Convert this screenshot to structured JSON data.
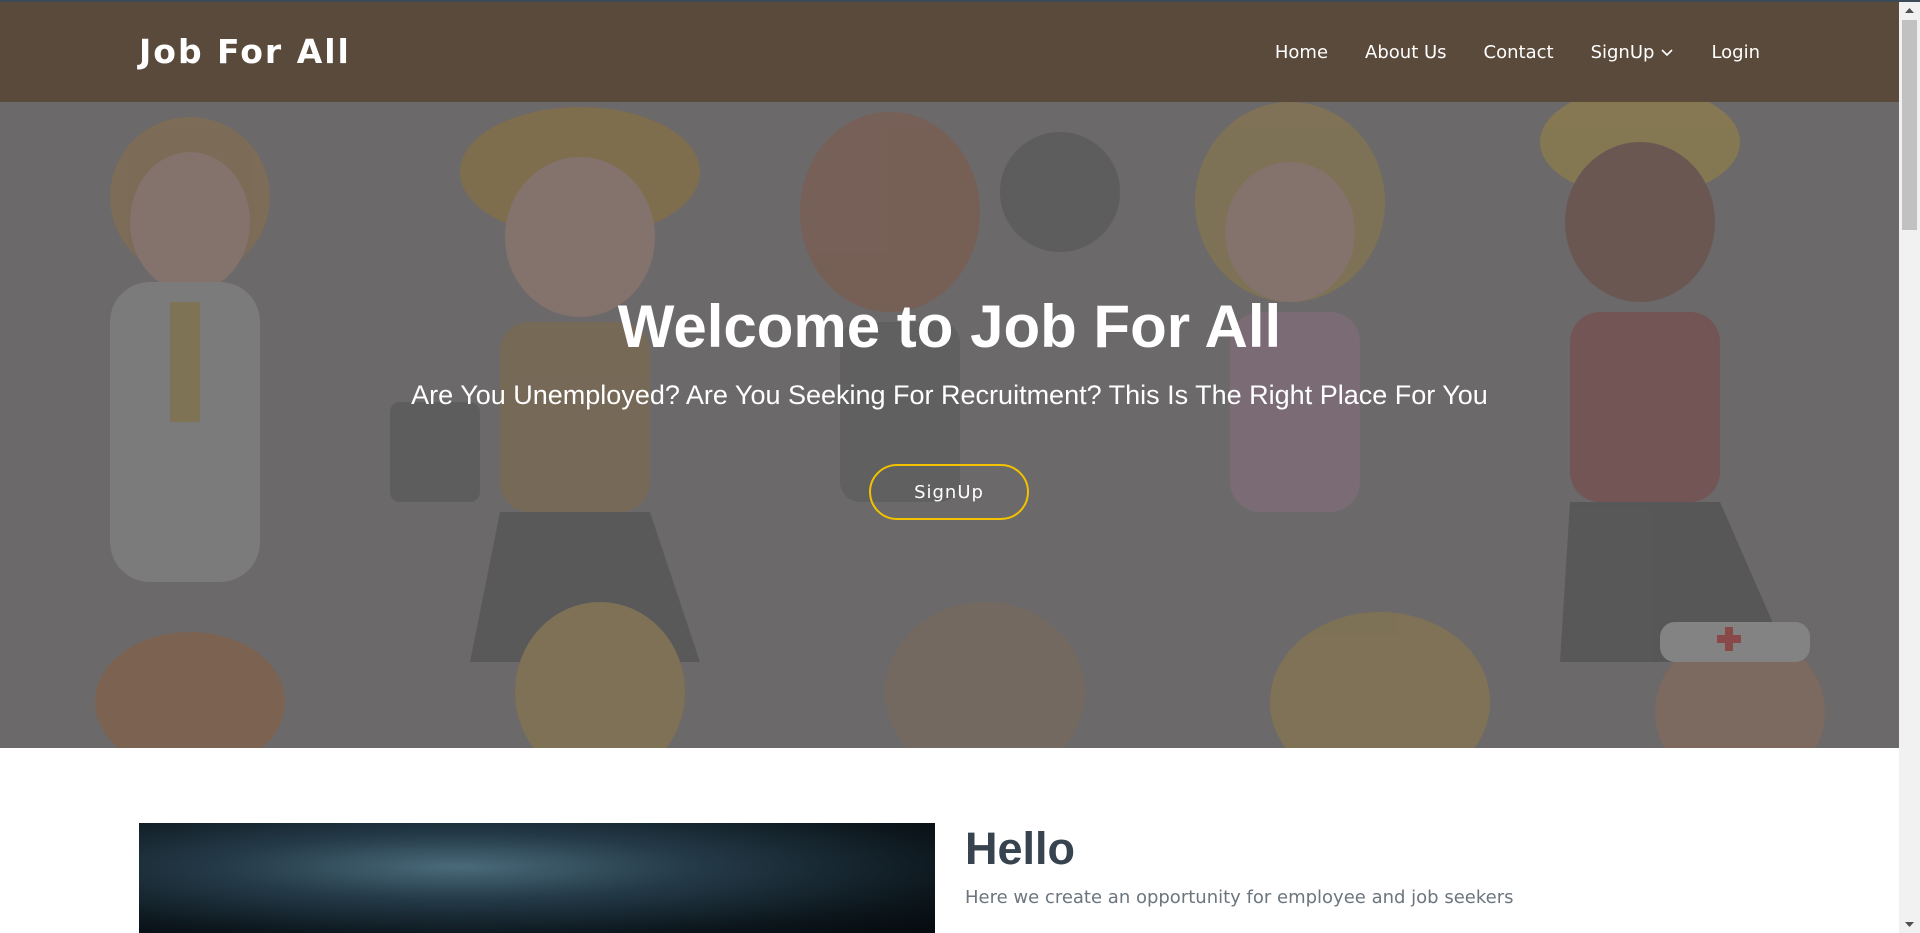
{
  "header": {
    "brand": "Job For All",
    "nav": [
      "Home",
      "About Us",
      "Contact",
      "SignUp",
      "Login"
    ]
  },
  "hero": {
    "title": "Welcome to Job For All",
    "subtitle": "Are You Unemployed? Are You Seeking For Recruitment? This Is The Right Place For You",
    "button": "SignUp"
  },
  "about": {
    "title": "Hello",
    "text": "Here we create an opportunity for employee and job seekers"
  },
  "colors": {
    "header_bg": "#5a4a3b",
    "hero_overlay": "#6d6b6b",
    "button_border": "#f2c200",
    "heading": "#37434f"
  }
}
